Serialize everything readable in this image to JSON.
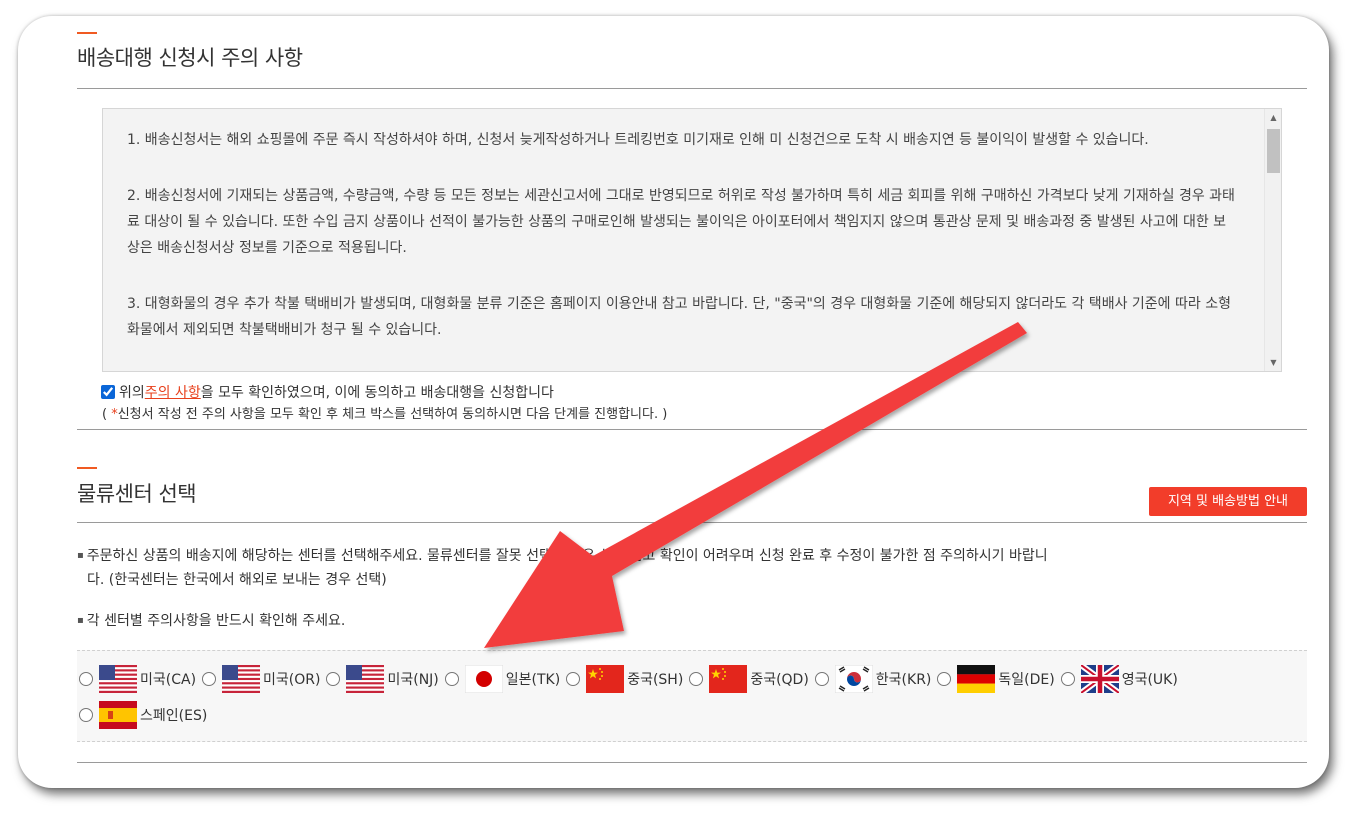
{
  "notice": {
    "title": "배송대행 신청시 주의 사항",
    "terms": [
      "1. 배송신청서는 해외 쇼핑몰에 주문 즉시 작성하셔야 하며, 신청서 늦게작성하거나 트레킹번호 미기재로 인해 미 신청건으로 도착 시 배송지연 등 불이익이 발생할 수 있습니다.",
      "2. 배송신청서에 기재되는 상품금액, 수량금액, 수량 등 모든 정보는 세관신고서에 그대로 반영되므로 허위로 작성 불가하며 특히 세금 회피를 위해 구매하신 가격보다 낮게 기재하실 경우 과태료 대상이 될 수 있습니다. 또한 수입 금지 상품이나 선적이 불가능한 상품의 구매로인해 발생되는 불이익은 아이포터에서 책임지지 않으며 통관상 문제 및 배송과정 중 발생된 사고에 대한 보상은 배송신청서상 정보를 기준으로 적용됩니다.",
      "3. 대형화물의 경우 추가 착불 택배비가 발생되며, 대형화물 분류 기준은 홈페이지 이용안내 참고 바랍니다. 단, \"중국\"의 경우 대형화물 기준에 해당되지 않더라도 각 택배사 기준에 따라 소형화물에서 제외되면 착불택배비가 청구 될 수 있습니다."
    ],
    "agree_prefix": "위의 ",
    "agree_link": "주의 사항",
    "agree_suffix": "을 모두 확인하였으며, 이에 동의하고 배송대행을 신청합니다",
    "agree_checked": true,
    "note_open": "( ",
    "note_star": "*",
    "note_text": "신청서 작성 전 주의 사항을 모두 확인 후 체크 박스를 선택하여 동의하시면 다음 단계를 진행합니다. )"
  },
  "logistics": {
    "title": "물류센터 선택",
    "guide_button": "지역 및 배송방법 안내",
    "bullet_1_line1": "주문하신 상품의 배송지에 해당하는 센터를 선택해주세요. 물류센터를 잘못 선택할 경우 상품 입고 확인이 어려우며 신청 완료 후 수정이 불가한 점 주의하시기 바랍니",
    "bullet_1_line2": "다. (한국센터는 한국에서 해외로 보내는 경우 선택)",
    "bullet_2": "각 센터별 주의사항을 반드시 확인해 주세요.",
    "centers": [
      {
        "label": "미국(CA)",
        "flag": "us-flag-icon"
      },
      {
        "label": "미국(OR)",
        "flag": "us-flag-icon"
      },
      {
        "label": "미국(NJ)",
        "flag": "us-flag-icon"
      },
      {
        "label": "일본(TK)",
        "flag": "japan-flag-icon"
      },
      {
        "label": "중국(SH)",
        "flag": "china-flag-icon"
      },
      {
        "label": "중국(QD)",
        "flag": "china-flag-icon"
      },
      {
        "label": "한국(KR)",
        "flag": "korea-flag-icon"
      },
      {
        "label": "독일(DE)",
        "flag": "germany-flag-icon"
      },
      {
        "label": "영국(UK)",
        "flag": "uk-flag-icon"
      },
      {
        "label": "스페인(ES)",
        "flag": "spain-flag-icon"
      }
    ]
  },
  "colors": {
    "accent": "#f05a22",
    "button": "#f23d2a",
    "arrow": "#f23d3d"
  }
}
